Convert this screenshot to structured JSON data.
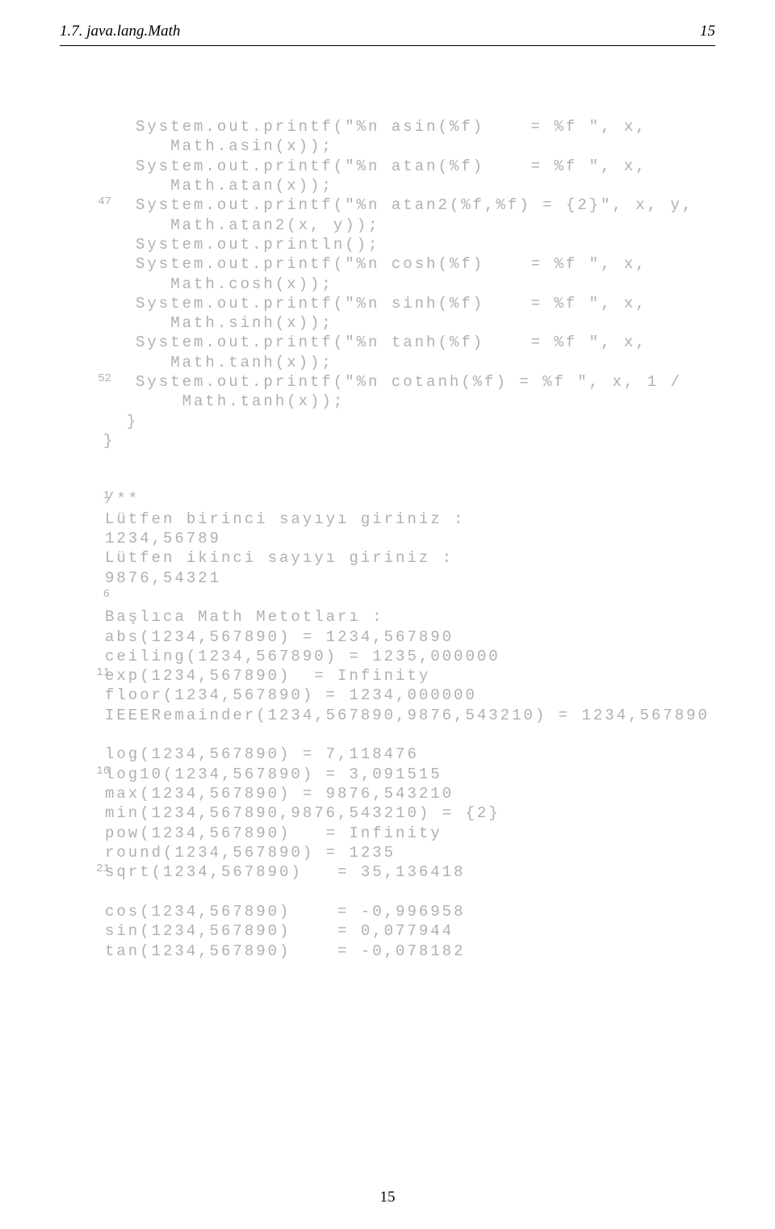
{
  "header": {
    "section": "1.7. java.lang.Math",
    "page_number_top": "15"
  },
  "code1": {
    "lines": {
      "l0": "System.out.printf(\"%n asin(%f)    = %f \", x,",
      "l1": "   Math.asin(x));",
      "l2": "System.out.printf(\"%n atan(%f)    = %f \", x,",
      "l3": "   Math.atan(x));",
      "l4": "System.out.printf(\"%n atan2(%f,%f) = {2}\", x, y,",
      "l5": "   Math.atan2(x, y));",
      "l6": "System.out.println();",
      "l7": "System.out.printf(\"%n cosh(%f)    = %f \", x,",
      "l8": "   Math.cosh(x));",
      "l9": "System.out.printf(\"%n sinh(%f)    = %f \", x,",
      "l10": "   Math.sinh(x));",
      "l11": "System.out.printf(\"%n tanh(%f)    = %f \", x,",
      "l12": "   Math.tanh(x));",
      "l13": "System.out.printf(\"%n cotanh(%f) = %f \", x, 1 /",
      "l14": "    Math.tanh(x));",
      "l15": "  }",
      "l16": "}"
    },
    "nums": {
      "n47": "47",
      "n52": "52"
    }
  },
  "code2": {
    "lines": {
      "l0": "/**",
      "l1": "Lütfen birinci sayıyı giriniz :",
      "l2": "1234,56789",
      "l3": "Lütfen ikinci sayıyı giriniz :",
      "l4": "9876,54321",
      "l5": "",
      "l6": "",
      "l7": "Başlıca Math Metotları :",
      "l8": "abs(1234,567890) = 1234,567890",
      "l9": "ceiling(1234,567890) = 1235,000000",
      "l10": "exp(1234,567890)  = Infinity",
      "l11": "floor(1234,567890) = 1234,000000",
      "l12": "IEEERemainder(1234,567890,9876,543210) = 1234,567890",
      "l13": "",
      "l14": "log(1234,567890) = 7,118476",
      "l15": "log10(1234,567890) = 3,091515",
      "l16": "max(1234,567890) = 9876,543210",
      "l17": "min(1234,567890,9876,543210) = {2}",
      "l18": "pow(1234,567890)   = Infinity",
      "l19": "round(1234,567890) = 1235",
      "l20": "sqrt(1234,567890)   = 35,136418",
      "l21": "",
      "l22": "cos(1234,567890)    = -0,996958",
      "l23": "sin(1234,567890)    = 0,077944",
      "l24": "tan(1234,567890)    = -0,078182"
    },
    "nums": {
      "n1": "1",
      "n6": "6",
      "n11": "11",
      "n16": "16",
      "n21": "21"
    }
  },
  "footer": {
    "page_number_bottom": "15"
  }
}
